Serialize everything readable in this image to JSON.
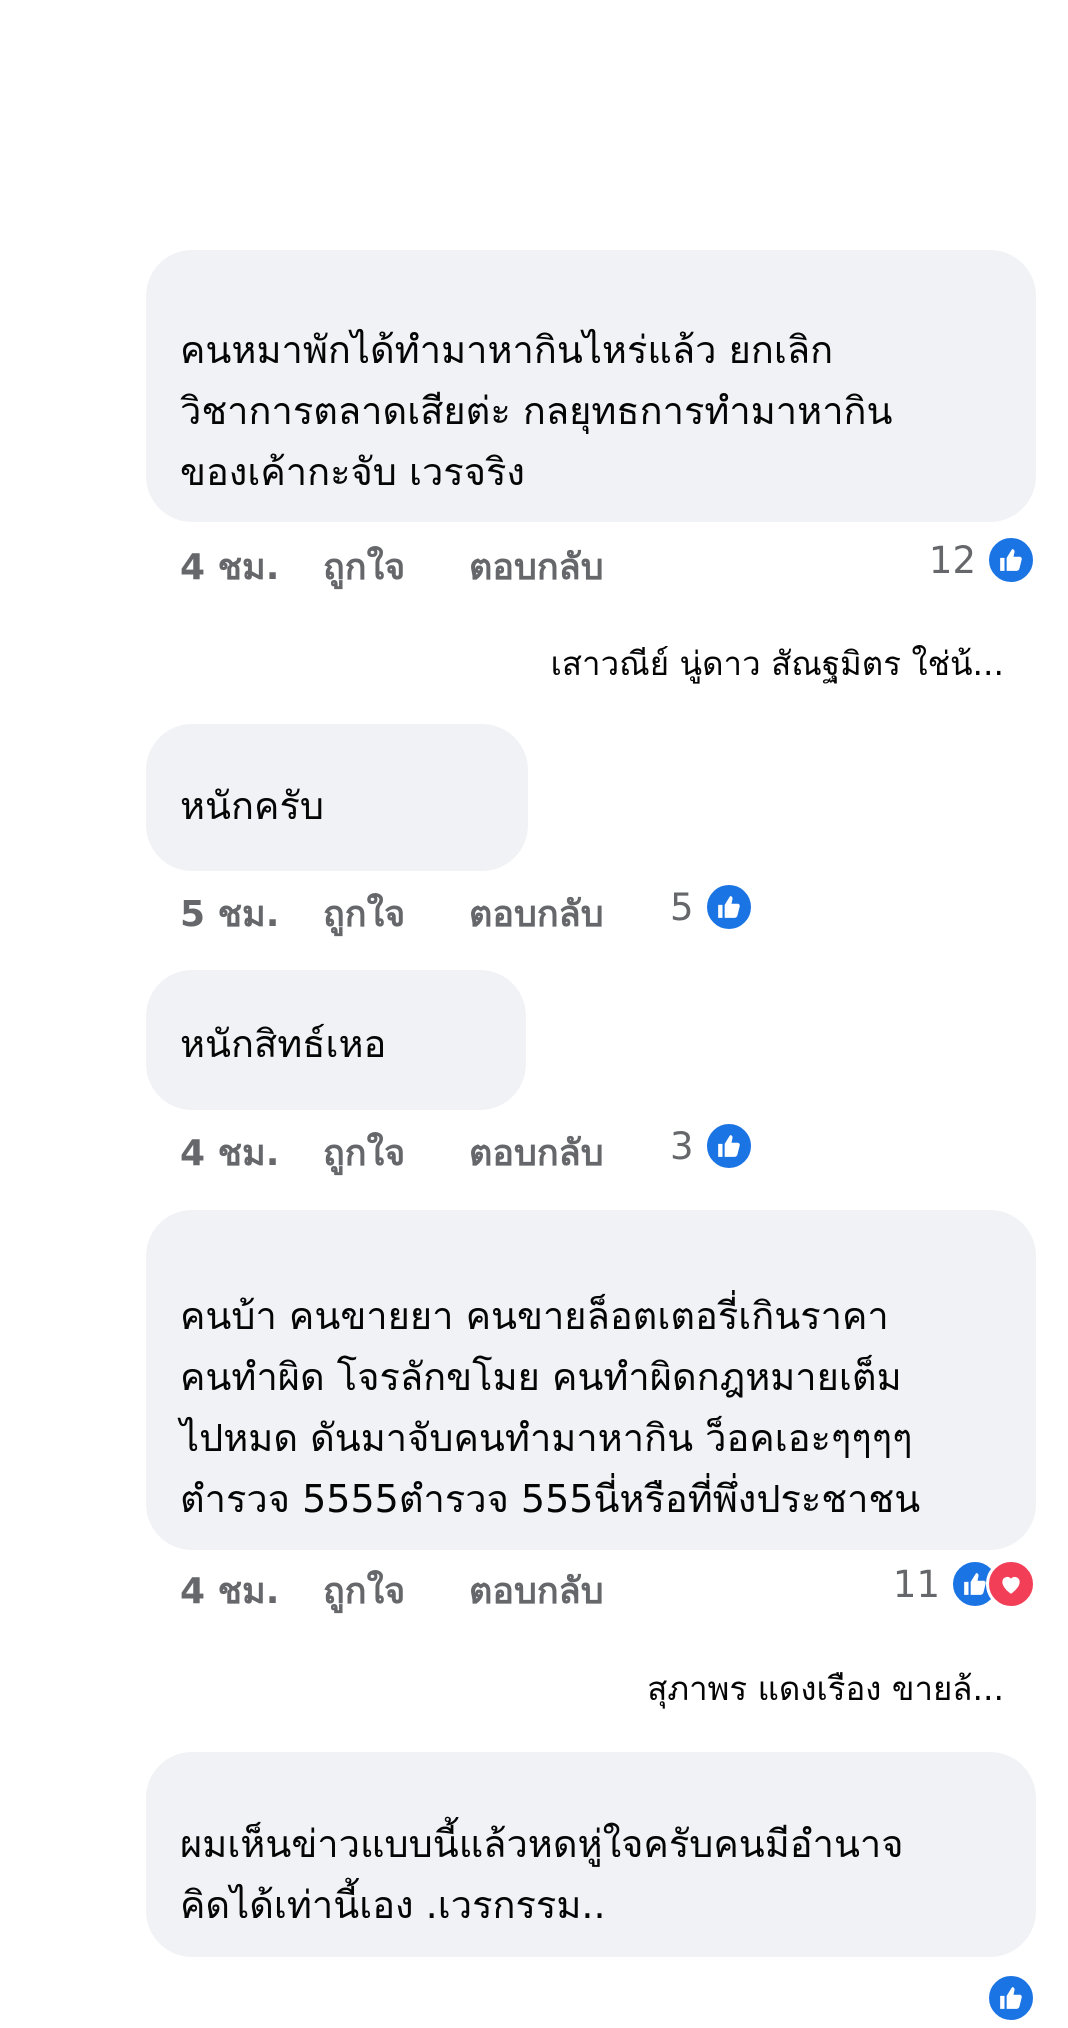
{
  "comments": [
    {
      "text": "คนหมาพักได้ทำมาหากินไหร่แล้ว ยกเลิก\nวิชาการตลาดเสียต่ะ กลยุทธการทำมาหากิน\nของเค้ากะจับ เวรจริง",
      "time": "4 ชม.",
      "like_label": "ถูกใจ",
      "reply_label": "ตอบกลับ",
      "reactions_count": "12",
      "reaction_icons": [
        "like-icon"
      ],
      "reply_preview": "เสาวณีย์ นู่ดาว สัณฐมิตร ใช่น้..."
    },
    {
      "text": "หนักครับ",
      "time": "5 ชม.",
      "like_label": "ถูกใจ",
      "reply_label": "ตอบกลับ",
      "reactions_count": "5",
      "reaction_icons": [
        "like-icon"
      ]
    },
    {
      "text": "หนักสิทธ์เหอ",
      "time": "4 ชม.",
      "like_label": "ถูกใจ",
      "reply_label": "ตอบกลับ",
      "reactions_count": "3",
      "reaction_icons": [
        "like-icon"
      ]
    },
    {
      "text": "คนบ้า คนขายยา คนขายล็อตเตอรี่เกินราคา\nคนทำผิด โจรลักขโมย คนทำผิดกฎหมายเต็ม\nไปหมด ดันมาจับคนทำมาหากิน ว็อคเอะๆๆๆๆ\nตำรวจ 5555ตำรวจ 555นี่หรือที่พึ่งประชาชน",
      "time": "4 ชม.",
      "like_label": "ถูกใจ",
      "reply_label": "ตอบกลับ",
      "reactions_count": "11",
      "reaction_icons": [
        "like-icon",
        "love-icon"
      ],
      "reply_preview": "สุภาพร แดงเรือง ขายล้..."
    },
    {
      "text": "ผมเห็นข่าวแบบนี้แล้วหดหู่ใจครับคนมีอำนาจ\nคิดได้เท่านี้เอง .เวรกรรม..",
      "reaction_icons": [
        "like-icon"
      ]
    }
  ],
  "colors": {
    "bubble": "#f0f2f5",
    "meta_text": "#65676b",
    "like_blue": "#1b74e4",
    "love_red": "#f33e58"
  }
}
